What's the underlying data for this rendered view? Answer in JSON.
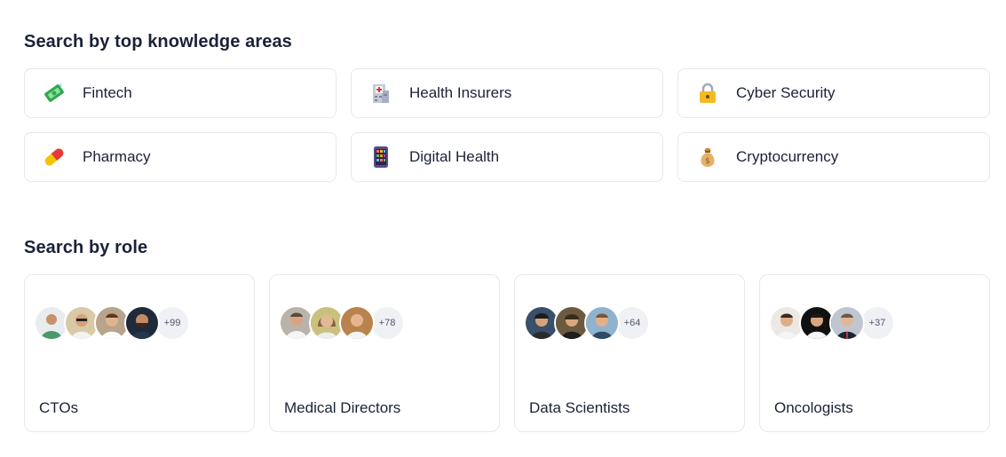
{
  "knowledge_section": {
    "title": "Search by top knowledge areas",
    "areas": [
      {
        "label": "Fintech",
        "icon": "money-with-wings-icon"
      },
      {
        "label": "Health Insurers",
        "icon": "hospital-icon"
      },
      {
        "label": "Cyber Security",
        "icon": "lock-icon"
      },
      {
        "label": "Pharmacy",
        "icon": "pill-icon"
      },
      {
        "label": "Digital Health",
        "icon": "mobile-phone-icon"
      },
      {
        "label": "Cryptocurrency",
        "icon": "money-bag-icon"
      }
    ]
  },
  "role_section": {
    "title": "Search by role",
    "roles": [
      {
        "label": "CTOs",
        "more": "+99"
      },
      {
        "label": "Medical Directors",
        "more": "+78"
      },
      {
        "label": "Data Scientists",
        "more": "+64"
      },
      {
        "label": "Oncologists",
        "more": "+37"
      }
    ]
  },
  "colors": {
    "text": "#1a2238",
    "border": "#e6e8ee",
    "badge_bg": "#f0f1f4"
  }
}
